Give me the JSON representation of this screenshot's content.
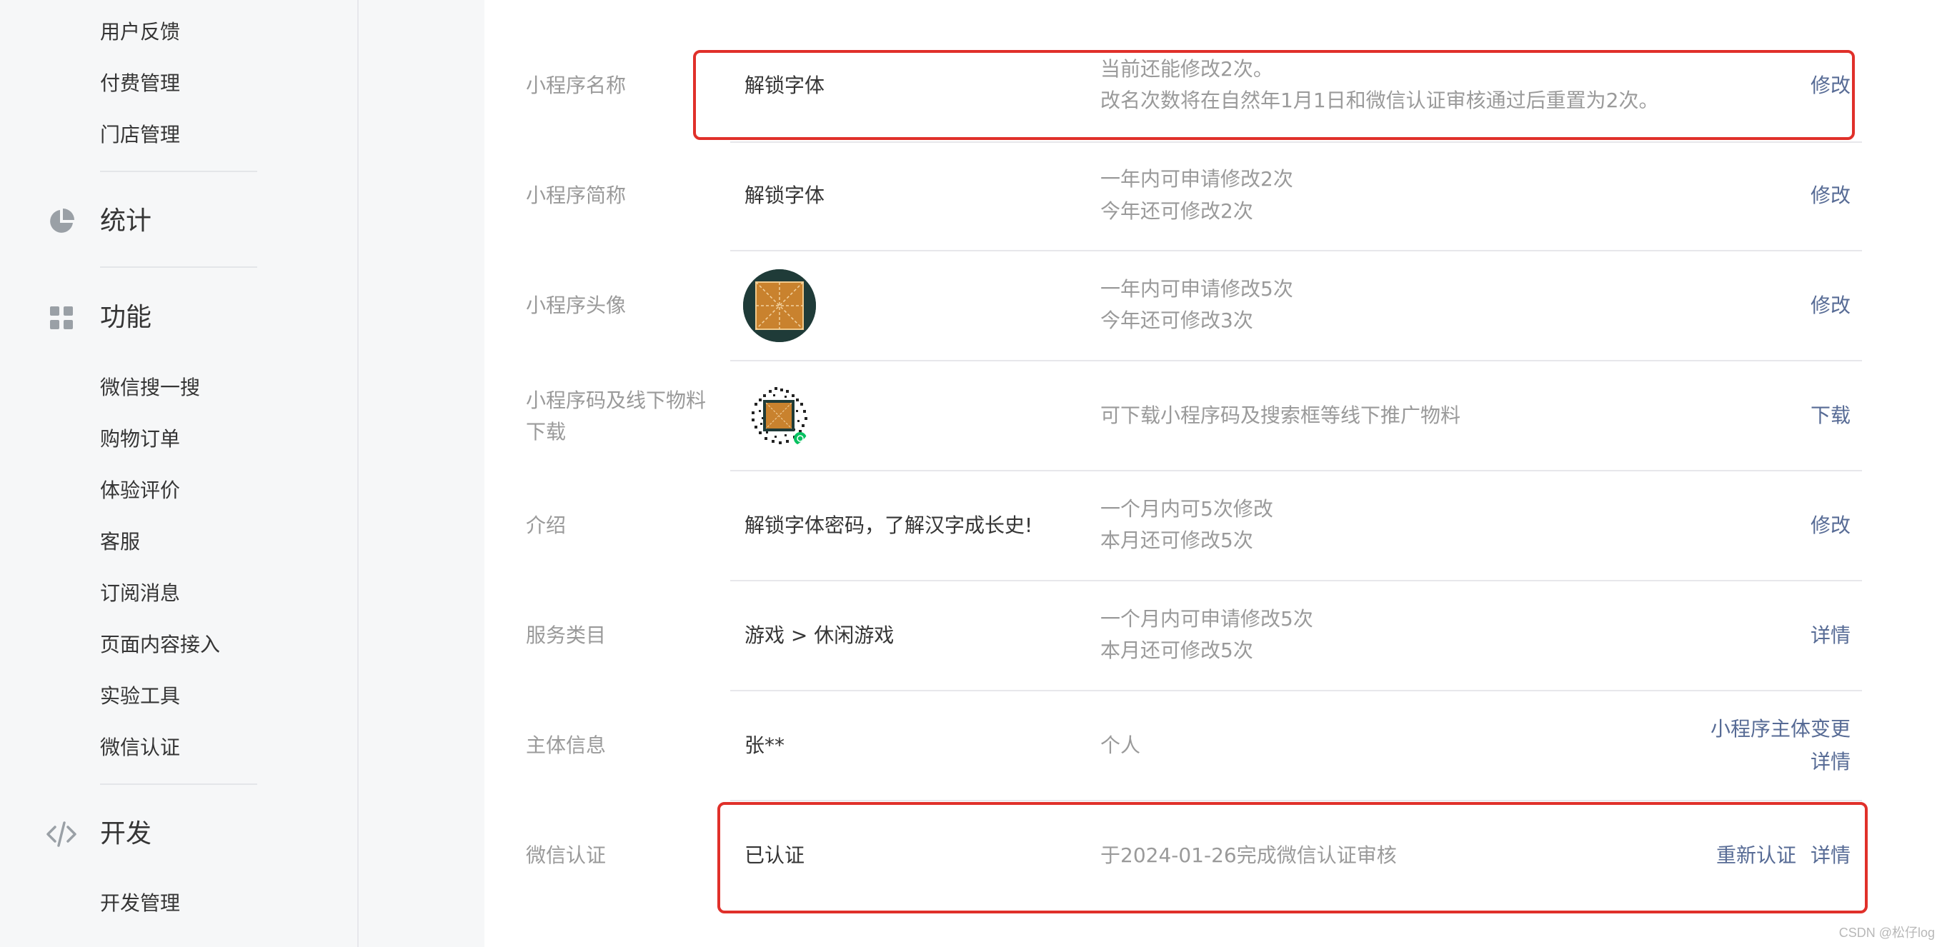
{
  "sidebar": {
    "top_items": [
      "用户反馈",
      "付费管理",
      "门店管理"
    ],
    "stats": {
      "label": "统计",
      "icon": "pie-chart-icon"
    },
    "features": {
      "label": "功能",
      "icon": "grid-icon",
      "items": [
        "微信搜一搜",
        "购物订单",
        "体验评价",
        "客服",
        "订阅消息",
        "页面内容接入",
        "实验工具",
        "微信认证"
      ]
    },
    "dev": {
      "label": "开发",
      "icon": "code-icon",
      "items": [
        "开发管理"
      ]
    }
  },
  "rows": {
    "name": {
      "label": "小程序名称",
      "value": "解锁字体",
      "desc1": "当前还能修改2次。",
      "desc2": "改名次数将在自然年1月1日和微信认证审核通过后重置为2次。",
      "action": "修改"
    },
    "short_name": {
      "label": "小程序简称",
      "value": "解锁字体",
      "desc1": "一年内可申请修改2次",
      "desc2": "今年还可修改2次",
      "action": "修改"
    },
    "avatar": {
      "label": "小程序头像",
      "desc1": "一年内可申请修改5次",
      "desc2": "今年还可修改3次",
      "action": "修改"
    },
    "qrcode": {
      "label_line1": "小程序码及线下物料",
      "label_line2": "下载",
      "desc": "可下载小程序码及搜索框等线下推广物料",
      "action": "下载"
    },
    "intro": {
      "label": "介绍",
      "value": "解锁字体密码，了解汉字成长史!",
      "desc1": "一个月内可5次修改",
      "desc2": "本月还可修改5次",
      "action": "修改"
    },
    "category": {
      "label": "服务类目",
      "value": "游戏 > 休闲游戏",
      "desc1": "一个月内可申请修改5次",
      "desc2": "本月还可修改5次",
      "action": "详情"
    },
    "entity": {
      "label": "主体信息",
      "value": "张**",
      "desc": "个人",
      "action1": "小程序主体变更",
      "action2": "详情"
    },
    "wechat_auth": {
      "label": "微信认证",
      "value": "已认证",
      "desc": "于2024-01-26完成微信认证审核",
      "action1": "重新认证",
      "action2": "详情"
    }
  },
  "colors": {
    "link": "#576b95",
    "highlight": "#e0302a",
    "label": "#9a9a9a"
  },
  "watermark": "CSDN @松仔log"
}
